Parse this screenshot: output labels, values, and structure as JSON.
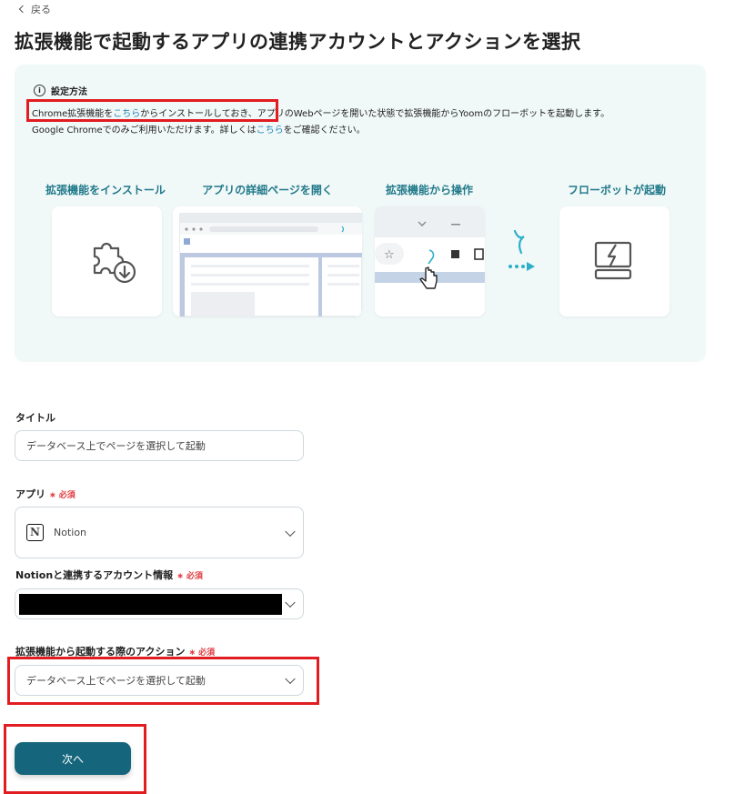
{
  "header": {
    "back_label": "戻る",
    "title": "拡張機能で起動するアプリの連携アカウントとアクションを選択"
  },
  "howto": {
    "title": "設定方法",
    "line1_a": "Chrome拡張機能を",
    "line1_link": "こちら",
    "line1_b": "からインストールしておき、",
    "line1_c": "アプリのWebページを開いた状態で拡張機能からYoomのフローボットを起動します。",
    "line2_a": "Google Chromeでのみご利用いただけます。詳しくは",
    "line2_link": "こちら",
    "line2_b": "をご確認ください。",
    "steps": [
      {
        "label": "拡張機能をインストール",
        "icon": "puzzle-download-icon"
      },
      {
        "label": "アプリの詳細ページを開く",
        "icon": "browser-page-illustration"
      },
      {
        "label": "拡張機能から操作",
        "icon": "toolbar-click-illustration"
      },
      {
        "label": "フローボットが起動",
        "icon": "flowbot-icon"
      }
    ]
  },
  "form": {
    "title_label": "タイトル",
    "title_value": "データベース上でページを選択して起動",
    "app_label": "アプリ",
    "required": "必須",
    "app_value": "Notion",
    "account_label": "Notionと連携するアカウント情報",
    "action_label": "拡張機能から起動する際のアクション",
    "action_value": "データベース上でページを選択して起動"
  },
  "next_button": "次へ",
  "colors": {
    "accent": "#15667c",
    "link": "#1b87b5",
    "required": "#e0393e",
    "highlight": "#e11d22",
    "panel": "#f1f8f8"
  }
}
